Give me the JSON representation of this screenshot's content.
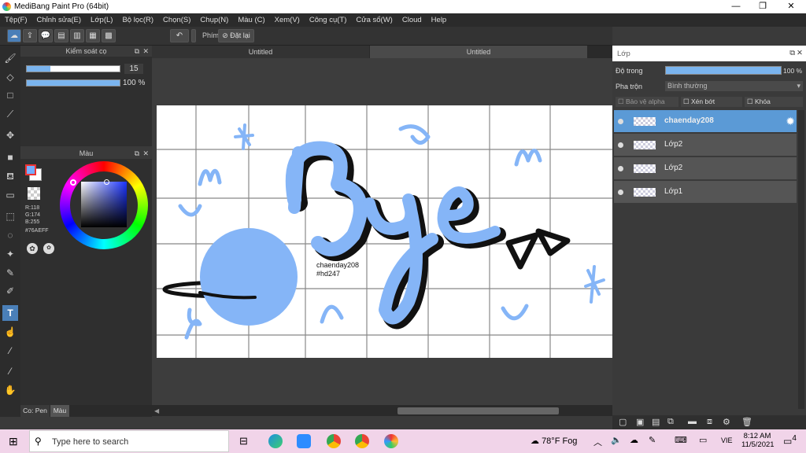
{
  "window": {
    "title": "MediBang Paint Pro (64bit)"
  },
  "menu": [
    "Tệp(F)",
    "Chỉnh sửa(E)",
    "Lớp(L)",
    "Bộ lọc(R)",
    "Chọn(S)",
    "Chụp(N)",
    "Màu (C)",
    "Xem(V)",
    "Công cụ(T)",
    "Cửa sổ(W)",
    "Cloud",
    "Help"
  ],
  "toolbar": {
    "phim_label": "Phím",
    "reset_label": "Đặt lại"
  },
  "brush_panel": {
    "title": "Kiểm soát cọ",
    "size": "15",
    "opacity": "100 %",
    "size_fraction": 0.25,
    "opacity_fraction": 1.0
  },
  "color_panel": {
    "title": "Màu",
    "r": "R:118",
    "g": "G:174",
    "b": "B:255",
    "hex": "#76AEFF",
    "fg": "#76AEFF",
    "bg": "#ffffff"
  },
  "bottom_tabs": {
    "pen": "Co: Pen",
    "color": "Màu"
  },
  "doc_tabs": [
    "Untitled",
    "Untitled"
  ],
  "canvas": {
    "note_line1": "chaenday208",
    "note_line2": "#hd247",
    "art_color": "#85b5f7"
  },
  "layer_panel": {
    "title": "Lớp",
    "opacity_label": "Độ trong",
    "opacity_value": "100 %",
    "blend_label": "Pha trộn",
    "blend_value": "Bình thường",
    "protect_alpha": "Bảo vệ alpha",
    "clip": "Xén bớt",
    "lock": "Khóa",
    "layers": [
      {
        "name": "chaenday208",
        "selected": true
      },
      {
        "name": "Lớp2",
        "selected": false
      },
      {
        "name": "Lớp2",
        "selected": false
      },
      {
        "name": "Lớp1",
        "selected": false
      }
    ]
  },
  "taskbar": {
    "search_placeholder": "Type here to search",
    "weather": "78°F  Fog",
    "lang": "VIE",
    "time": "8:12 AM",
    "date": "11/5/2021",
    "notif": "4"
  }
}
